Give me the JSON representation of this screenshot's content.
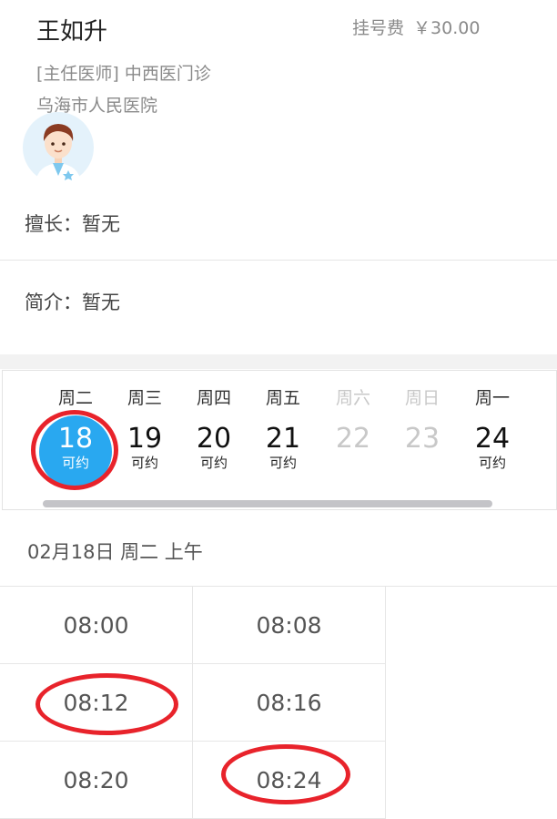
{
  "doctor": {
    "name": "王如升",
    "fee_label": "挂号费",
    "fee_value": "￥30.00",
    "title": "[主任医师] 中西医门诊",
    "hospital": "乌海市人民医院",
    "avatar_icon": "doctor-avatar-icon"
  },
  "profile": {
    "specialty": "擅长：暂无",
    "intro": "简介：暂无"
  },
  "calendar": {
    "days": [
      {
        "weekday": "周二",
        "date": "18",
        "status": "可约",
        "selected": true
      },
      {
        "weekday": "周三",
        "date": "19",
        "status": "可约"
      },
      {
        "weekday": "周四",
        "date": "20",
        "status": "可约"
      },
      {
        "weekday": "周五",
        "date": "21",
        "status": "可约"
      },
      {
        "weekday": "周六",
        "date": "22",
        "status": ""
      },
      {
        "weekday": "周日",
        "date": "23",
        "status": ""
      },
      {
        "weekday": "周一",
        "date": "24",
        "status": "可约"
      }
    ],
    "selected_color": "#29a8f0"
  },
  "session": {
    "title": "02月18日 周二 上午",
    "slots": [
      "08:00",
      "08:08",
      "08:12",
      "08:16",
      "08:20",
      "08:24"
    ]
  },
  "annotation_color": "#e8232b"
}
